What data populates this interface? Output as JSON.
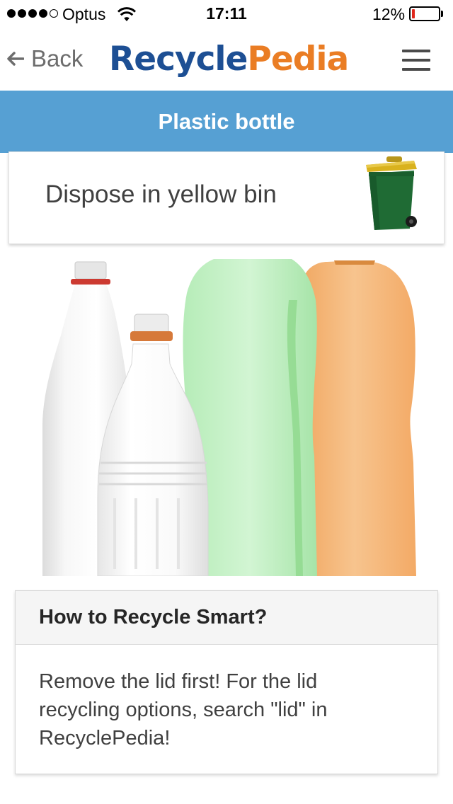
{
  "status_bar": {
    "carrier": "Optus",
    "time": "17:11",
    "battery_text": "12%",
    "battery_level": 0.12,
    "signal_bars_filled": 4,
    "signal_bars_total": 5
  },
  "header": {
    "back_label": "Back",
    "logo_part_a": "Recycle",
    "logo_part_b": "Pedia",
    "back_icon": "arrow-left-icon",
    "menu_icon": "hamburger-menu-icon"
  },
  "page": {
    "title": "Plastic bottle"
  },
  "disposal": {
    "instruction": "Dispose in yellow bin",
    "bin_icon": "yellow-lid-wheelie-bin-icon"
  },
  "image": {
    "subject": "plastic-bottles-photo"
  },
  "tips": {
    "heading": "How to Recycle Smart?",
    "body": "Remove the lid first! For the lid recycling options, search \"lid\" in RecyclePedia!"
  },
  "colors": {
    "brand_blue": "#1d4f94",
    "brand_orange": "#ea7d24",
    "banner_blue": "#56a0d3",
    "bin_green": "#1f6b34",
    "bin_lid_yellow": "#d9b21e",
    "battery_red": "#e0261b"
  }
}
